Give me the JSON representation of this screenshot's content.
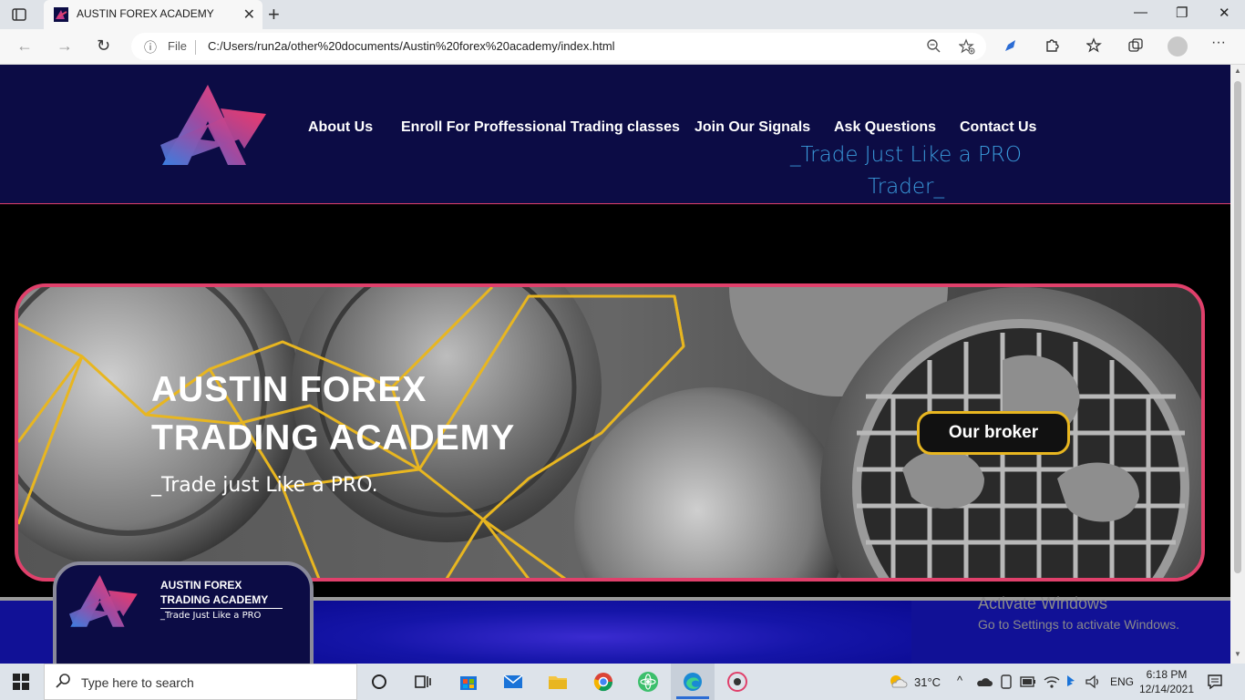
{
  "browser": {
    "tab_title": "AUSTIN FOREX ACADEMY",
    "tab_close": "✕",
    "new_tab": "+",
    "minimize": "—",
    "restore": "❐",
    "close": "✕",
    "back": "←",
    "forward": "→",
    "reload": "↻",
    "info": "ⓘ",
    "file_label": "File",
    "url": "C:/Users/run2a/other%20documents/Austin%20forex%20academy/index.html",
    "more": "···"
  },
  "site": {
    "nav": [
      {
        "label": "About Us"
      },
      {
        "label": "Enroll For Proffessional Trading classes"
      },
      {
        "label": "Join Our Signals"
      },
      {
        "label": "Ask Questions"
      },
      {
        "label": "Contact Us"
      }
    ],
    "tagline_line1": "_Trade Just Like a PRO",
    "tagline_line2": "Trader_",
    "hero": {
      "title_line1": "AUSTIN FOREX",
      "title_line2": "TRADING ACADEMY",
      "subtitle": "_Trade just Like a PRO.",
      "broker_button": "Our broker"
    },
    "card": {
      "title_line1": "AUSTIN FOREX",
      "title_line2": "TRADING ACADEMY",
      "subtitle": "_Trade Just Like a PRO"
    },
    "colors": {
      "header_bg": "#0c0c45",
      "accent_pink": "#e0406b",
      "tagline_blue": "#3a9bdc",
      "gold": "#e8b620"
    }
  },
  "watermark": {
    "title": "Activate Windows",
    "subtitle": "Go to Settings to activate Windows."
  },
  "taskbar": {
    "search_placeholder": "Type here to search",
    "temperature": "31°C",
    "language": "ENG",
    "time": "6:18 PM",
    "date": "12/14/2021"
  }
}
